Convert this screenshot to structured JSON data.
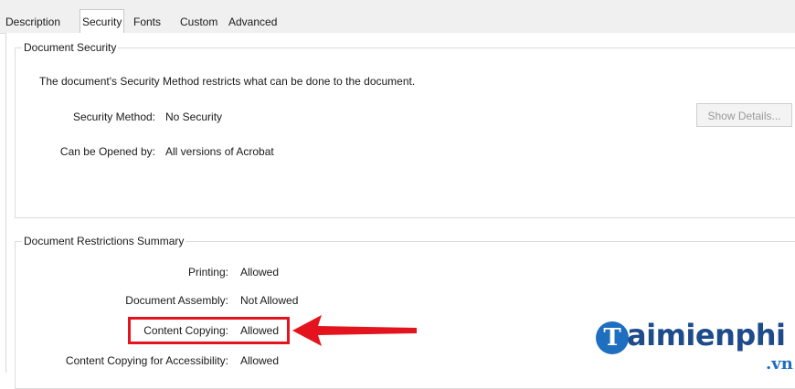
{
  "tabs": [
    {
      "label": "Description"
    },
    {
      "label": "Security"
    },
    {
      "label": "Fonts"
    },
    {
      "label": "Custom"
    },
    {
      "label": "Advanced"
    }
  ],
  "security": {
    "legend": "Document Security",
    "description": "The document's Security Method restricts what can be done to the document.",
    "method_label": "Security Method:",
    "method_value": "No Security",
    "opened_label": "Can be Opened by:",
    "opened_value": "All versions of Acrobat",
    "details_button": "Show Details..."
  },
  "restrictions": {
    "legend": "Document Restrictions Summary",
    "rows": [
      {
        "label": "Printing:",
        "value": "Allowed"
      },
      {
        "label": "Document Assembly:",
        "value": "Not Allowed"
      },
      {
        "label": "Content Copying:",
        "value": "Allowed"
      },
      {
        "label": "Content Copying for Accessibility:",
        "value": "Allowed"
      }
    ]
  },
  "watermark": {
    "initial": "T",
    "text": "aimienphi",
    "suffix": ".vn"
  },
  "colors": {
    "highlight": "#e4141e",
    "logo_blue": "#1e4c8a"
  }
}
